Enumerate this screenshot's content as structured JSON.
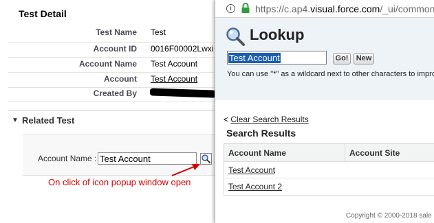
{
  "detail": {
    "title": "Test Detail",
    "rows": [
      {
        "label": "Test Name",
        "value": "Test",
        "is_link": false
      },
      {
        "label": "Account ID",
        "value": "0016F00002Lwxi",
        "is_link": false
      },
      {
        "label": "Account Name",
        "value": "Test Account",
        "is_link": false
      },
      {
        "label": "Account",
        "value": "Test Account",
        "is_link": true
      },
      {
        "label": "Created By",
        "value": "",
        "is_link": false
      }
    ]
  },
  "related": {
    "title": "Related Test",
    "field_label": "Account Name :",
    "field_value": "Test Account",
    "annotation": "On click of icon popup window open"
  },
  "popup": {
    "url_prefix": "https://c.ap4.",
    "url_domain": "visual.force.com",
    "url_rest": "/_ui/common_",
    "title": "Lookup",
    "search_value": "Test Account",
    "go_label": "Go!",
    "new_label": "New",
    "hint": "You can use \"*\" as a wildcard next to other characters to impro",
    "clear_prefix": "< ",
    "clear_link": "Clear Search Results",
    "results_title": "Search Results",
    "columns": [
      "Account Name",
      "Account Site"
    ],
    "results": [
      "Test Account",
      "Test Account 2"
    ],
    "footer": "Copyright © 2000-2018 sale"
  },
  "colors": {
    "annotation_red": "#d40000",
    "header_bg": "#eef3f8",
    "lock_green": "#2e9e3c"
  }
}
